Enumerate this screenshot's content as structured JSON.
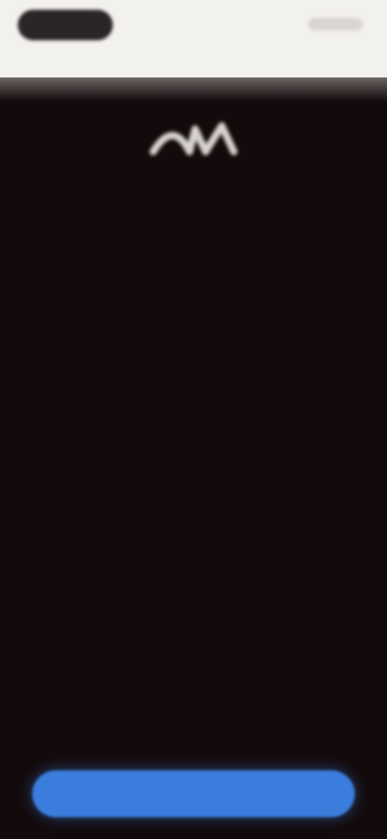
{
  "status_bar": {
    "pill_label": "",
    "right_label": ""
  },
  "logo": {
    "icon": "brand-logo-icon"
  },
  "message": {
    "title": "",
    "body": ""
  },
  "footer": {
    "hint": "",
    "primary_button_label": ""
  },
  "colors": {
    "background": "#130a0b",
    "top_bar": "#f3f1ee",
    "accent": "#3b7ddd"
  }
}
